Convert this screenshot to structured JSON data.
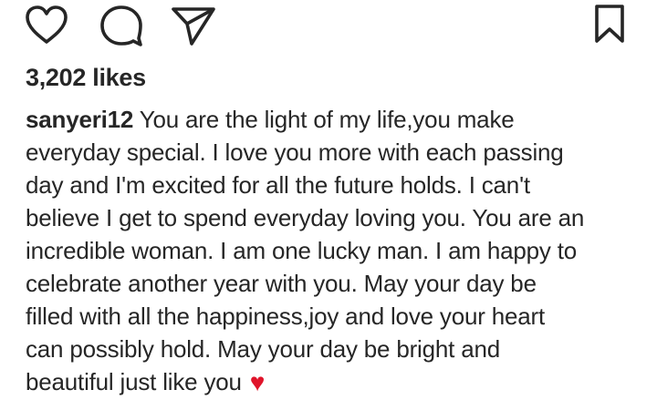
{
  "actions": {
    "like_icon": "heart-outline-icon",
    "comment_icon": "speech-bubble-icon",
    "share_icon": "paper-plane-icon",
    "save_icon": "bookmark-icon"
  },
  "likes": {
    "label": "3,202 likes"
  },
  "caption": {
    "username": "sanyeri12",
    "first_line": " You are the light of my life,you make",
    "lines": [
      "everyday special. I love you more with each passing",
      "day and I'm excited for all the future holds. I can't",
      "believe I get to spend everyday loving you. You are an",
      "incredible woman. I am one lucky man. I am happy to",
      "celebrate another year with you. May your day be",
      "filled with all the happiness,joy and love your heart",
      "can possibly hold. May your day be bright and"
    ],
    "last_line": "beautiful just like you ",
    "emoji": "♥"
  },
  "colors": {
    "text": "#262626",
    "emoji_heart": "#e0142a"
  }
}
